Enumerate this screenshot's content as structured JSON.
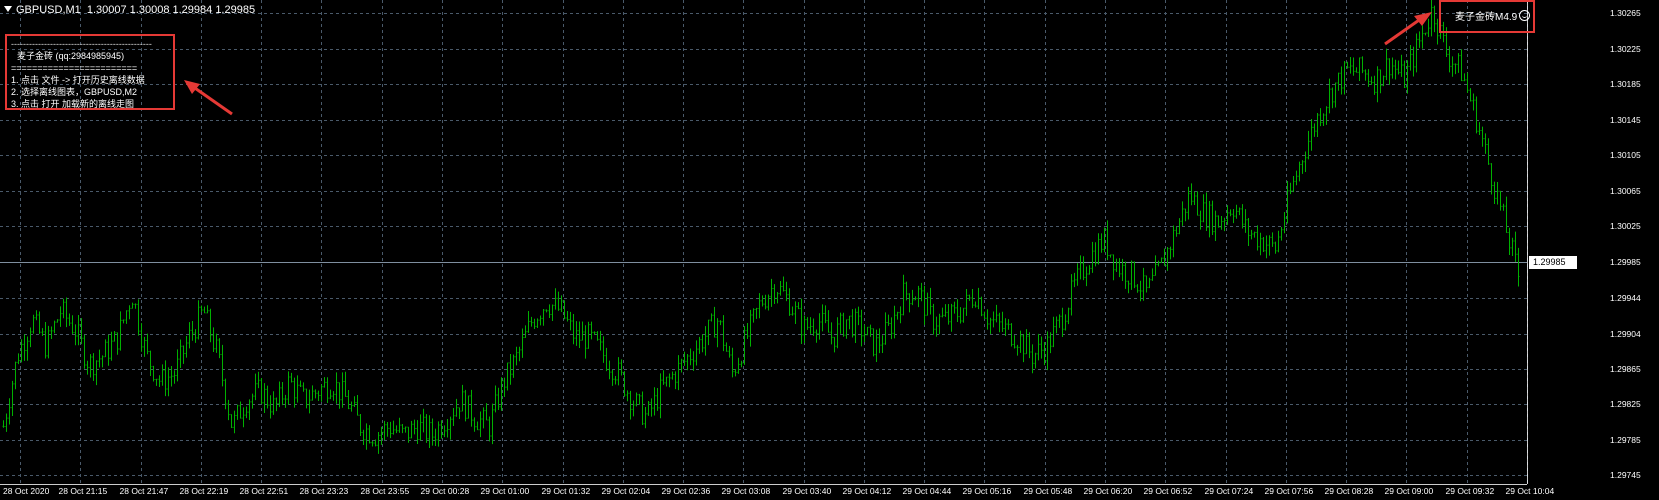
{
  "header": {
    "symbol": "GBPUSD,M1",
    "ohlc": "1.30007 1.30008 1.29984 1.29985"
  },
  "info_box": {
    "title": "麦子金砖 (qq:2984985945)",
    "separator": "========================",
    "steps": [
      "1.   点击 文件 -> 打开历史离线数据",
      "2.   选择离线图表，GBPUSD,M2",
      "3.   点击 打开 加载新的离线走图"
    ]
  },
  "badge": {
    "label": "麦子金砖M4.9"
  },
  "colors": {
    "candle": "#00b000",
    "grid": "#4a5a6a",
    "current_line": "#7f8f9f",
    "annotation": "#e53935"
  },
  "chart_data": {
    "type": "line",
    "symbol": "GBPUSD",
    "timeframe": "M1",
    "current_price": 1.29985,
    "yticks": [
      1.30265,
      1.30225,
      1.30185,
      1.30145,
      1.30105,
      1.30065,
      1.30025,
      1.29985,
      1.29944,
      1.29904,
      1.29865,
      1.29825,
      1.29785,
      1.29745
    ],
    "ylim": [
      1.29735,
      1.3028
    ],
    "xticks": [
      "28 Oct 2020",
      "28 Oct 21:15",
      "28 Oct 21:47",
      "28 Oct 22:19",
      "28 Oct 22:51",
      "28 Oct 23:23",
      "28 Oct 23:55",
      "29 Oct 00:28",
      "29 Oct 01:00",
      "29 Oct 01:32",
      "29 Oct 02:04",
      "29 Oct 02:36",
      "29 Oct 03:08",
      "29 Oct 03:40",
      "29 Oct 04:12",
      "29 Oct 04:44",
      "29 Oct 05:16",
      "29 Oct 05:48",
      "29 Oct 06:20",
      "29 Oct 06:52",
      "29 Oct 07:24",
      "29 Oct 07:56",
      "29 Oct 08:28",
      "29 Oct 09:00",
      "29 Oct 09:32",
      "29 Oct 10:04"
    ],
    "series": [
      {
        "values": [
          1.298,
          1.2988,
          1.2992,
          1.2989,
          1.2993,
          1.2991,
          1.2987,
          1.2988,
          1.299,
          1.2995,
          1.2988,
          1.2985,
          1.2986,
          1.299,
          1.2993,
          1.2988,
          1.298,
          1.2983,
          1.2984,
          1.2982,
          1.2985,
          1.2983,
          1.2984,
          1.2985,
          1.2983,
          1.298,
          1.2979,
          1.298,
          1.2979,
          1.298,
          1.2979,
          1.2981,
          1.2983,
          1.2981,
          1.298,
          1.2985,
          1.2988,
          1.2992,
          1.2994,
          1.2993,
          1.299,
          1.299,
          1.2988,
          1.2986,
          1.2983,
          1.2981,
          1.2984,
          1.2986,
          1.2988,
          1.299,
          1.2992,
          1.2986,
          1.299,
          1.2994,
          1.2996,
          1.2994,
          1.2991,
          1.2992,
          1.299,
          1.2992,
          1.2991,
          1.2989,
          1.2991,
          1.2995,
          1.2995,
          1.2992,
          1.2992,
          1.2993,
          1.2995,
          1.2992,
          1.2991,
          1.299,
          1.2988,
          1.2989,
          1.2992,
          1.2996,
          1.2999,
          1.3001,
          1.2998,
          1.2997,
          1.2995,
          1.2998,
          1.3002,
          1.3006,
          1.3004,
          1.3003,
          1.3005,
          1.3002,
          1.3001,
          1.3,
          1.3006,
          1.3011,
          1.3015,
          1.3018,
          1.302,
          1.302,
          1.3019,
          1.3021,
          1.3019,
          1.3023,
          1.3027,
          1.3022,
          1.302,
          1.3015,
          1.3009,
          1.3003,
          1.2997
        ]
      }
    ]
  },
  "annotations": {
    "arrows": 2
  }
}
